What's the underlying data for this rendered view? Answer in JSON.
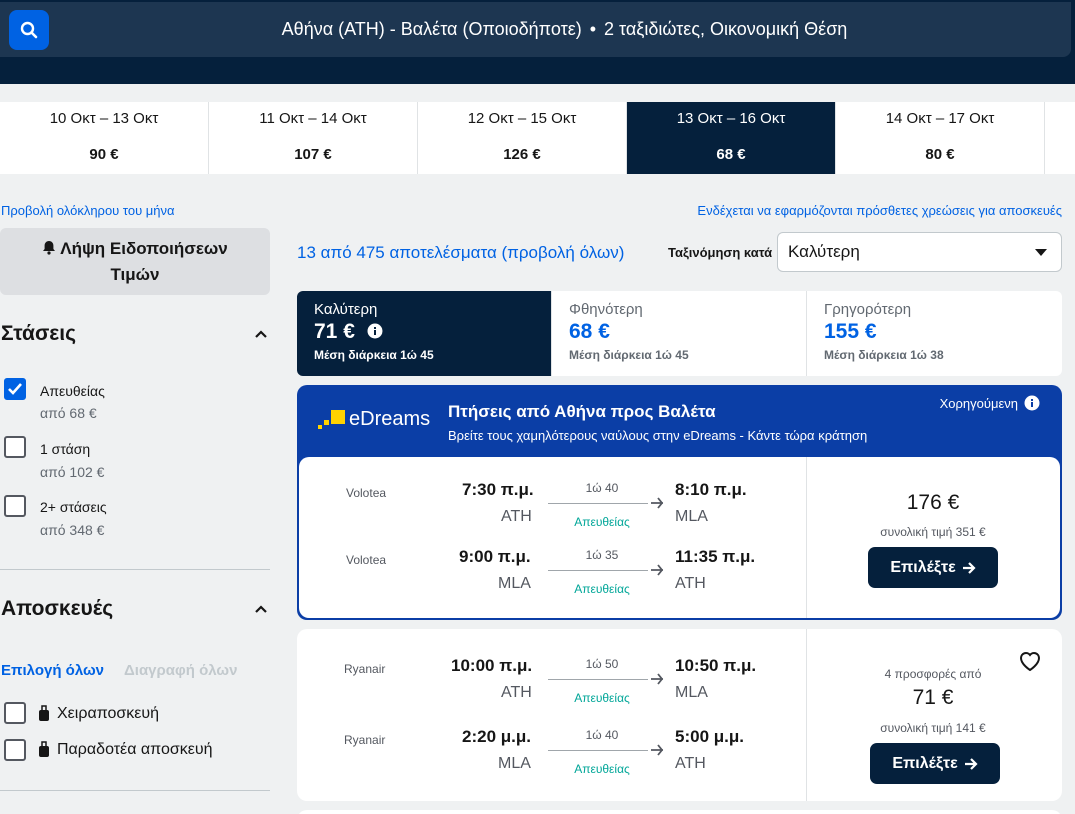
{
  "header": {
    "route": "Αθήνα (ATH) - Βαλέτα (Οποιοδήποτε)",
    "separator": "•",
    "travellers": "2 ταξιδιώτες, Οικονομική Θέση"
  },
  "dates": [
    {
      "range": "10 Οκτ – 13 Οκτ",
      "price": "90 €"
    },
    {
      "range": "11 Οκτ – 14 Οκτ",
      "price": "107 €"
    },
    {
      "range": "12 Οκτ – 15 Οκτ",
      "price": "126 €"
    },
    {
      "range": "13 Οκτ – 16 Οκτ",
      "price": "68 €"
    },
    {
      "range": "14 Οκτ – 17 Οκτ",
      "price": "80 €"
    }
  ],
  "links": {
    "month": "Προβολή ολόκληρου του μήνα",
    "fees": "Ενδέχεται να εφαρμόζονται πρόσθετες χρεώσεις για αποσκευές"
  },
  "sidebar": {
    "alert_line1": "Λήψη Ειδοποιήσεων",
    "alert_line2": "Τιμών",
    "stops_title": "Στάσεις",
    "stops": [
      {
        "label": "Απευθείας",
        "sub": "από 68 €",
        "checked": true
      },
      {
        "label": "1 στάση",
        "sub": "από 102 €",
        "checked": false
      },
      {
        "label": "2+ στάσεις",
        "sub": "από 348 €",
        "checked": false
      }
    ],
    "bags_title": "Αποσκευές",
    "select_all": "Επιλογή όλων",
    "clear_all": "Διαγραφή όλων",
    "bags": [
      {
        "label": "Χειραποσκευή"
      },
      {
        "label": "Παραδοτέα αποσκευή"
      }
    ]
  },
  "results": {
    "count": "13 από 475 αποτελέσματα (προβολή όλων)",
    "sort_label": "Ταξινόμηση κατά",
    "sort_value": "Καλύτερη"
  },
  "tabs": [
    {
      "title": "Καλύτερη",
      "price": "71 €",
      "sub": "Μέση διάρκεια 1ώ 45"
    },
    {
      "title": "Φθηνότερη",
      "price": "68 €",
      "sub": "Μέση διάρκεια 1ώ 45"
    },
    {
      "title": "Γρηγορότερη",
      "price": "155 €",
      "sub": "Μέση διάρκεια 1ώ 38"
    }
  ],
  "sponsored": {
    "logo": "eDreams",
    "title": "Πτήσεις από Αθήνα προς Βαλέτα",
    "subtitle": "Βρείτε τους χαμηλότερους ναύλους στην eDreams - Κάντε τώρα κράτηση",
    "tag": "Χορηγούμενη",
    "legs": [
      {
        "airline": "Volotea",
        "dep_time": "7:30 π.μ.",
        "dep_code": "ATH",
        "duration": "1ώ 40",
        "stops": "Απευθείας",
        "arr_time": "8:10 π.μ.",
        "arr_code": "MLA"
      },
      {
        "airline": "Volotea",
        "dep_time": "9:00 π.μ.",
        "dep_code": "MLA",
        "duration": "1ώ 35",
        "stops": "Απευθείας",
        "arr_time": "11:35 π.μ.",
        "arr_code": "ATH"
      }
    ],
    "price": "176 €",
    "total": "συνολική τιμή 351 €",
    "button": "Επιλέξτε"
  },
  "result2": {
    "legs": [
      {
        "airline": "Ryanair",
        "dep_time": "10:00 π.μ.",
        "dep_code": "ATH",
        "duration": "1ώ 50",
        "stops": "Απευθείας",
        "arr_time": "10:50 π.μ.",
        "arr_code": "MLA"
      },
      {
        "airline": "Ryanair",
        "dep_time": "2:20 μ.μ.",
        "dep_code": "MLA",
        "duration": "1ώ 40",
        "stops": "Απευθείας",
        "arr_time": "5:00 μ.μ.",
        "arr_code": "ATH"
      }
    ],
    "offers": "4 προσφορές από",
    "price": "71 €",
    "total": "συνολική τιμή 141 €",
    "button": "Επιλέξτε"
  },
  "colors": {
    "navy": "#05203c",
    "blue": "#0062e3",
    "sponsor": "#0b3ea6",
    "teal": "#00a698"
  }
}
